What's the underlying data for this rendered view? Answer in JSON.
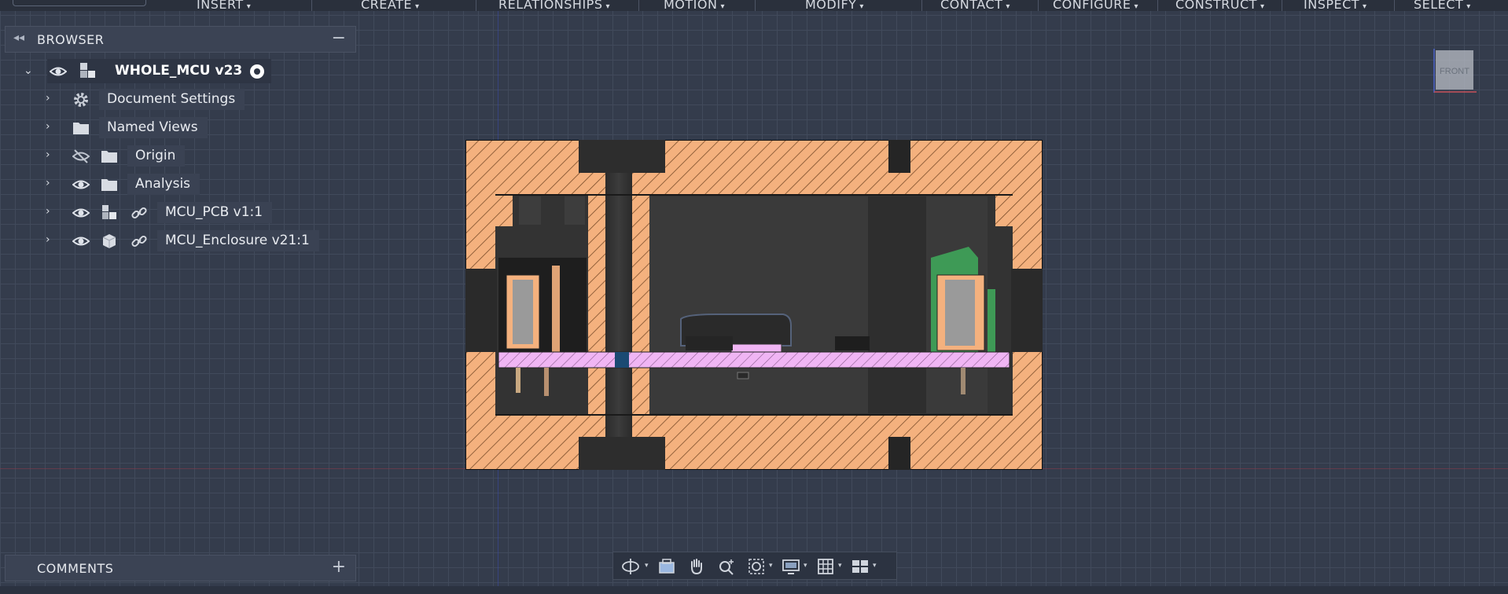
{
  "toolbar": {
    "menus": [
      "INSERT",
      "CREATE",
      "RELATIONSHIPS",
      "MOTION",
      "MODIFY",
      "CONTACT",
      "CONFIGURE",
      "CONSTRUCT",
      "INSPECT",
      "SELECT"
    ]
  },
  "browser": {
    "title": "BROWSER",
    "root": {
      "label": "WHOLE_MCU v23"
    },
    "items": [
      {
        "label": "Document Settings",
        "icon": "gear-icon"
      },
      {
        "label": "Named Views",
        "icon": "folder-icon"
      },
      {
        "label": "Origin",
        "icon": "folder-icon",
        "visibility": "hidden"
      },
      {
        "label": "Analysis",
        "icon": "folder-icon",
        "visibility": "visible"
      },
      {
        "label": "MCU_PCB v1:1",
        "icon": "component-icon",
        "visibility": "visible",
        "linked": true
      },
      {
        "label": "MCU_Enclosure v21:1",
        "icon": "body-icon",
        "visibility": "visible",
        "linked": true
      }
    ]
  },
  "comments": {
    "title": "COMMENTS"
  },
  "viewcube": {
    "face": "FRONT"
  },
  "colors": {
    "hatch": "#f4b17e",
    "pcb": "#f0b5f4",
    "connector_green": "#3e9a56",
    "background": "#343c4c"
  }
}
